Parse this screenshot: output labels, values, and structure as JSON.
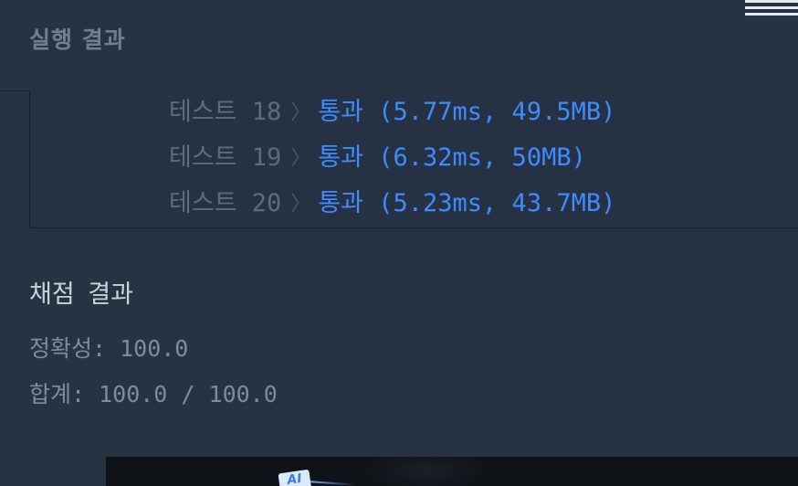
{
  "header": {
    "title": "실행 결과",
    "menu_icon": "hamburger-menu-icon"
  },
  "results": [
    {
      "label": "테스트",
      "number": "18",
      "result": "통과 (5.77ms, 49.5MB)"
    },
    {
      "label": "테스트",
      "number": "19",
      "result": "통과 (6.32ms, 50MB)"
    },
    {
      "label": "테스트",
      "number": "20",
      "result": "통과 (5.23ms, 43.7MB)"
    }
  ],
  "chevron_glyph": "〉",
  "score": {
    "title": "채점 결과",
    "accuracy": "정확성: 100.0",
    "total": "합계: 100.0 / 100.0"
  },
  "preview": {
    "badge": "AI"
  },
  "colors": {
    "background": "#263343",
    "pass": "#3d8bfd",
    "muted": "#5d6b7c"
  }
}
